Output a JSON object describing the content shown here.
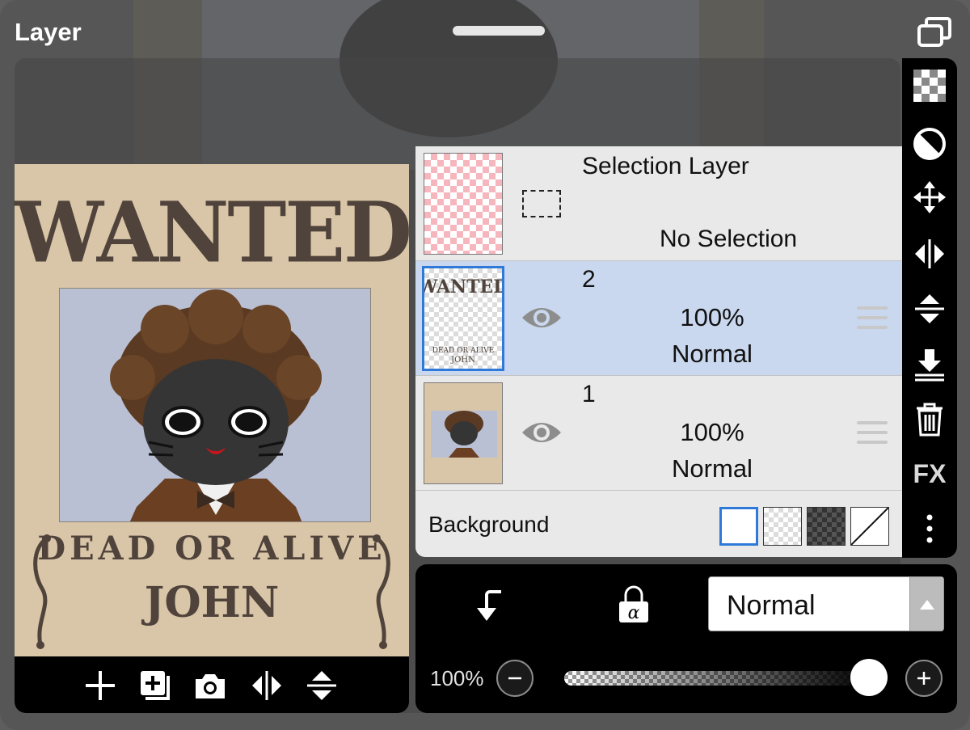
{
  "panel": {
    "title": "Layer"
  },
  "poster": {
    "headline": "WANTED",
    "subline": "DEAD OR ALIVE",
    "name": "JOHN"
  },
  "preview_toolbar": {
    "buttons": [
      "plus-icon",
      "add-layer-icon",
      "camera-icon",
      "flip-horizontal-icon",
      "flip-vertical-icon"
    ]
  },
  "layers": {
    "selection": {
      "title": "Selection Layer",
      "status": "No Selection"
    },
    "items": [
      {
        "name": "2",
        "opacity": "100%",
        "blend": "Normal",
        "selected": true,
        "visible": true
      },
      {
        "name": "1",
        "opacity": "100%",
        "blend": "Normal",
        "selected": false,
        "visible": true
      }
    ],
    "background": {
      "label": "Background",
      "options": [
        "white",
        "transparent",
        "dark-checker",
        "none"
      ],
      "selected": "white"
    }
  },
  "right_toolbar": {
    "buttons": [
      "checker-icon",
      "contrast-icon",
      "move-icon",
      "flip-horizontal-icon",
      "flip-vertical-icon",
      "merge-down-icon",
      "trash-icon"
    ],
    "fx_label": "FX"
  },
  "blend_controls": {
    "blend_mode": "Normal"
  },
  "opacity_controls": {
    "value_label": "100%",
    "value": 1.0
  },
  "colors": {
    "selected_row": "#c9d8ee",
    "accent": "#2f7ad9",
    "poster_bg": "#d9c6a8",
    "poster_text": "#4f433b"
  }
}
